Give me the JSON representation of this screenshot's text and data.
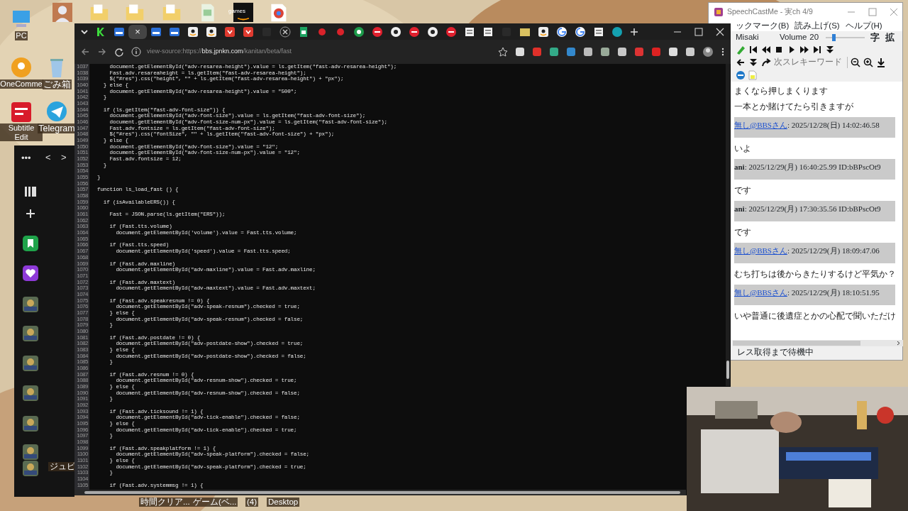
{
  "desktop": {
    "icons": [
      {
        "kind": "pc",
        "label": "PC"
      },
      {
        "kind": "orange",
        "label": "OneComme"
      },
      {
        "kind": "subtitle",
        "label": "Subtitle Edit"
      },
      {
        "kind": "recycle",
        "label": "ごみ箱"
      },
      {
        "kind": "telegram",
        "label": "Telegram"
      }
    ],
    "top_icons": [
      {
        "kind": "avatar"
      },
      {
        "kind": "folder"
      },
      {
        "kind": "folder"
      },
      {
        "kind": "folder"
      },
      {
        "kind": "file"
      },
      {
        "kind": "games",
        "label": "games"
      },
      {
        "kind": "chrome"
      }
    ],
    "side_label": "ジュピ",
    "taskbar_labels": [
      "時間クリア...",
      "ゲーム(ベ...",
      "(4)",
      "Desktop"
    ]
  },
  "side_panel": {
    "menu": "•••",
    "back": "<",
    "forward": ">",
    "apps": [
      {
        "kind": "library"
      },
      {
        "kind": "plus"
      },
      {
        "kind": "bookmark"
      },
      {
        "kind": "heart"
      },
      {
        "kind": "thumb"
      },
      {
        "kind": "thumb"
      },
      {
        "kind": "thumb"
      },
      {
        "kind": "thumb"
      },
      {
        "kind": "thumb"
      },
      {
        "kind": "thumb"
      },
      {
        "kind": "thumb"
      }
    ]
  },
  "browser": {
    "tab_close": "×",
    "tabs": [
      {
        "kind": "k",
        "selected": false
      },
      {
        "kind": "bbs",
        "selected": false
      },
      {
        "selected": true
      },
      {
        "kind": "bbs",
        "selected": false
      },
      {
        "kind": "bbs",
        "selected": false
      },
      {
        "kind": "amazon",
        "selected": false
      },
      {
        "kind": "amazon",
        "selected": false
      },
      {
        "kind": "shield",
        "selected": false
      },
      {
        "kind": "shield",
        "selected": false
      },
      {
        "kind": "blank",
        "selected": false
      },
      {
        "kind": "x",
        "selected": false
      },
      {
        "kind": "sheet",
        "selected": false
      },
      {
        "kind": "reddot",
        "selected": false
      },
      {
        "kind": "reddot",
        "selected": false
      },
      {
        "kind": "greencircle",
        "selected": false
      },
      {
        "kind": "redcircle",
        "selected": false
      },
      {
        "kind": "whitecircle",
        "selected": false
      },
      {
        "kind": "redcircle",
        "selected": false
      },
      {
        "kind": "whitecircle",
        "selected": false
      },
      {
        "kind": "redcircle",
        "selected": false
      },
      {
        "kind": "doc",
        "selected": false
      },
      {
        "kind": "doc",
        "selected": false
      },
      {
        "kind": "blank",
        "selected": false
      },
      {
        "kind": "folder",
        "selected": false
      },
      {
        "kind": "amazon",
        "selected": false
      },
      {
        "kind": "google",
        "selected": false
      },
      {
        "kind": "google",
        "selected": false
      },
      {
        "kind": "doc",
        "selected": false
      },
      {
        "kind": "tealcircle",
        "selected": false
      }
    ],
    "address": {
      "prefix": "view-source:https://",
      "domain": "bbs.jpnkn.com",
      "path": "/kanitan/beta/fast"
    },
    "code_lines": [
      {
        "number": "1037",
        "text": "    document.getElementById(\"adv-resarea-height\").value = ls.getItem(\"fast-adv-resarea-height\");"
      },
      {
        "number": "1038",
        "text": "    Fast.adv.resareaheight = ls.getItem(\"fast-adv-resarea-height\");"
      },
      {
        "number": "1039",
        "text": "    $(\"#res\").css(\"height\", \"\" + ls.getItem(\"fast-adv-resarea-height\") + \"px\");"
      },
      {
        "number": "1040",
        "text": "  } else {"
      },
      {
        "number": "1041",
        "text": "    document.getElementById(\"adv-resarea-height\").value = \"500\";"
      },
      {
        "number": "1042",
        "text": "  }"
      },
      {
        "number": "1043"
      },
      {
        "number": "1044",
        "text": "  if (ls.getItem(\"fast-adv-font-size\")) {"
      },
      {
        "number": "1045",
        "text": "    document.getElementById(\"adv-font-size\").value = ls.getItem(\"fast-adv-font-size\");"
      },
      {
        "number": "1046",
        "text": "    document.getElementById(\"adv-font-size-num-px\").value = ls.getItem(\"fast-adv-font-size\");"
      },
      {
        "number": "1047",
        "text": "    Fast.adv.fontsize = ls.getItem(\"fast-adv-font-size\");"
      },
      {
        "number": "1048",
        "text": "    $(\"#res\").css(\"fontSize\", \"\" + ls.getItem(\"fast-adv-font-size\") + \"px\");"
      },
      {
        "number": "1049",
        "text": "  } else {"
      },
      {
        "number": "1050",
        "text": "    document.getElementById(\"adv-font-size\").value = \"12\";"
      },
      {
        "number": "1051",
        "text": "    document.getElementById(\"adv-font-size-num-px\").value = \"12\";"
      },
      {
        "number": "1052",
        "text": "    Fast.adv.fontsize = 12;"
      },
      {
        "number": "1053",
        "text": "  }"
      },
      {
        "number": "1054"
      },
      {
        "number": "1055",
        "text": "}"
      },
      {
        "number": "1056"
      },
      {
        "number": "1057",
        "text": "function ls_load_fast () {"
      },
      {
        "number": "1058"
      },
      {
        "number": "1059",
        "text": "  if (isAvailableERS()) {"
      },
      {
        "number": "1060"
      },
      {
        "number": "1061",
        "text": "    Fast = JSON.parse(ls.getItem(\"ERS\"));"
      },
      {
        "number": "1062"
      },
      {
        "number": "1063",
        "text": "    if (Fast.tts.volume)"
      },
      {
        "number": "1064",
        "text": "      document.getElementById('volume').value = Fast.tts.volume;"
      },
      {
        "number": "1065"
      },
      {
        "number": "1066",
        "text": "    if (Fast.tts.speed)"
      },
      {
        "number": "1067",
        "text": "      document.getElementById('speed').value = Fast.tts.speed;"
      },
      {
        "number": "1068"
      },
      {
        "number": "1069",
        "text": "    if (Fast.adv.maxline)"
      },
      {
        "number": "1070",
        "text": "      document.getElementById(\"adv-maxline\").value = Fast.adv.maxline;"
      },
      {
        "number": "1071"
      },
      {
        "number": "1072",
        "text": "    if (Fast.adv.maxtext)"
      },
      {
        "number": "1073",
        "text": "      document.getElementById(\"adv-maxtext\").value = Fast.adv.maxtext;"
      },
      {
        "number": "1074"
      },
      {
        "number": "1075",
        "text": "    if (Fast.adv.speakresnum != 0) {"
      },
      {
        "number": "1076",
        "text": "      document.getElementById(\"adv-speak-resnum\").checked = true;"
      },
      {
        "number": "1077",
        "text": "    } else {"
      },
      {
        "number": "1078",
        "text": "      document.getElementById(\"adv-speak-resnum\").checked = false;"
      },
      {
        "number": "1079",
        "text": "    }"
      },
      {
        "number": "1080"
      },
      {
        "number": "1081",
        "text": "    if (Fast.adv.postdate != 0) {"
      },
      {
        "number": "1082",
        "text": "      document.getElementById(\"adv-postdate-show\").checked = true;"
      },
      {
        "number": "1083",
        "text": "    } else {"
      },
      {
        "number": "1084",
        "text": "      document.getElementById(\"adv-postdate-show\").checked = false;"
      },
      {
        "number": "1085",
        "text": "    }"
      },
      {
        "number": "1086"
      },
      {
        "number": "1087",
        "text": "    if (Fast.adv.resnum != 0) {"
      },
      {
        "number": "1088",
        "text": "      document.getElementById(\"adv-resnum-show\").checked = true;"
      },
      {
        "number": "1089",
        "text": "    } else {"
      },
      {
        "number": "1090",
        "text": "      document.getElementById(\"adv-resnum-show\").checked = false;"
      },
      {
        "number": "1091",
        "text": "    }"
      },
      {
        "number": "1092"
      },
      {
        "number": "1093",
        "text": "    if (Fast.adv.ticksound != 1) {"
      },
      {
        "number": "1094",
        "text": "      document.getElementById(\"adv-tick-enable\").checked = false;"
      },
      {
        "number": "1095",
        "text": "    } else {"
      },
      {
        "number": "1096",
        "text": "      document.getElementById(\"adv-tick-enable\").checked = true;"
      },
      {
        "number": "1097",
        "text": "    }"
      },
      {
        "number": "1098"
      },
      {
        "number": "1099",
        "text": "    if (Fast.adv.speakplatform != 1) {"
      },
      {
        "number": "1100",
        "text": "      document.getElementById(\"adv-speak-platform\").checked = false;"
      },
      {
        "number": "1101",
        "text": "    } else {"
      },
      {
        "number": "1102",
        "text": "      document.getElementById(\"adv-speak-platform\").checked = true;"
      },
      {
        "number": "1103",
        "text": "    }"
      },
      {
        "number": "1104"
      },
      {
        "number": "1105",
        "text": "    if (Fast.adv.systemmsg != 1) {"
      }
    ]
  },
  "speechcast": {
    "title": "SpeechCastMe - 実ch 4/9",
    "menu": [
      "ックマーク(B)",
      "読み上げ(S)",
      "ヘルプ(H)"
    ],
    "voice": "Misaki",
    "volume_label": "Volume",
    "volume_value": "20",
    "volume": {
      "level": 0.2
    },
    "font_buttons": [
      "字",
      "拡"
    ],
    "search_placeholder": "次スレキーワード",
    "posts": [
      {
        "kind": "body",
        "text": "まくなら押しまくります"
      },
      {
        "kind": "body",
        "text": "一本とか賭けてたら引きますが"
      },
      {
        "kind": "header",
        "name": "無し@BBSさん",
        "link": true,
        "rest": ": 2025/12/28(日) 14:02:46.58"
      },
      {
        "kind": "body",
        "text": "いよ"
      },
      {
        "kind": "header",
        "name": "ani",
        "link": false,
        "rest": ": 2025/12/29(月) 16:40:25.99 ID:bBPscOt9"
      },
      {
        "kind": "body",
        "text": "です"
      },
      {
        "kind": "header",
        "name": "ani",
        "link": false,
        "rest": ": 2025/12/29(月) 17:30:35.56 ID:bBPscOt9"
      },
      {
        "kind": "body",
        "text": "です"
      },
      {
        "kind": "header",
        "name": "無し@BBSさん",
        "link": true,
        "rest": ": 2025/12/29(月) 18:09:47.06"
      },
      {
        "kind": "body",
        "text": "むち打ちは後からきたりするけど平気か？"
      },
      {
        "kind": "header",
        "name": "無し@BBSさん",
        "link": true,
        "rest": ": 2025/12/29(月) 18:10:51.95"
      },
      {
        "kind": "body",
        "text": "いや普通に後遺症とかの心配で聞いただけ"
      }
    ],
    "status": "レス取得まで待機中"
  }
}
